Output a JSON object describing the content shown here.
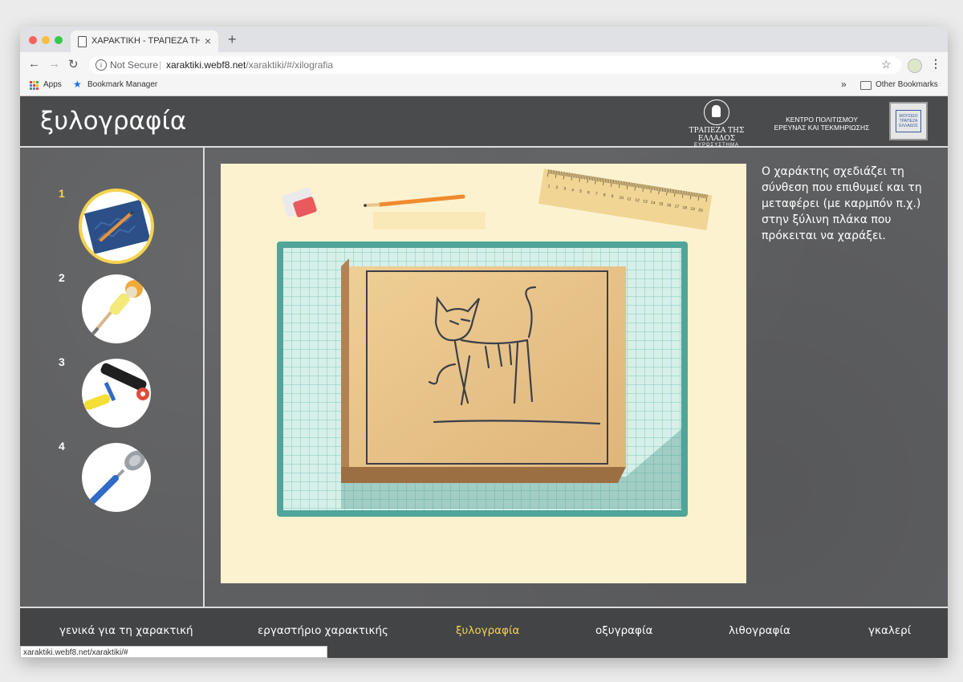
{
  "browser": {
    "tab_title": "ΧΑΡΑΚΤΙΚΗ - ΤΡΑΠΕΖΑ ΤΗΣ Ε",
    "new_tab_glyph": "+",
    "tab_close_glyph": "×",
    "security_label": "Not Secure",
    "url_host": "xaraktiki.webf8.net",
    "url_path": "/xaraktiki/#/xilografia",
    "bookmarks": {
      "apps_label": "Apps",
      "manager_label": "Bookmark Manager",
      "overflow_glyph": "»",
      "other_label": "Other Bookmarks"
    },
    "status_url": "xaraktiki.webf8.net/xaraktiki/#",
    "colors": {
      "close": "#fc605b",
      "minimize": "#fdbc40",
      "maximize": "#34c84a"
    }
  },
  "header": {
    "title": "ξυλογραφία",
    "bank_name": "ΤΡΑΠΕΖΑ ΤΗΣ ΕΛΛΑΔΟΣ",
    "bank_sub": "ΕΥΡΩΣΥΣΤΗΜΑ",
    "centre_line1": "ΚΕΝΤΡΟ ΠΟΛΙΤΙΣΜΟΥ",
    "centre_line2": "ΕΡΕΥΝΑΣ ΚΑΙ ΤΕΚΜΗΡΙΩΣΗΣ",
    "museum_logo_text": "ΜΟΥΣΕΙΟ ΤΡΑΠΕΖΑ ΕΛΛΑΔΟΣ"
  },
  "steps": [
    {
      "number": "1",
      "icon": "sketch-paper-pencil-icon",
      "active": true
    },
    {
      "number": "2",
      "icon": "gouge-tool-icon",
      "active": false
    },
    {
      "number": "3",
      "icon": "ink-roller-icon",
      "active": false
    },
    {
      "number": "4",
      "icon": "spoon-icon",
      "active": false
    }
  ],
  "description": "Ο χαράκτης σχεδιάζει τη σύνθεση που επιθυμεί και τη μεταφέρει (με καρμπόν π.χ.) στην ξύλινη πλάκα που πρόκειται να χαράξει.",
  "illustration": {
    "ruler_numbers": [
      "1",
      "2",
      "3",
      "4",
      "5",
      "6",
      "7",
      "8",
      "9",
      "10",
      "11",
      "12",
      "13",
      "14",
      "15",
      "16",
      "17",
      "18",
      "19",
      "20"
    ]
  },
  "nav": [
    {
      "label": "γενικά για τη χαρακτική",
      "active": false
    },
    {
      "label": "εργαστήριο χαρακτικής",
      "active": false
    },
    {
      "label": "ξυλογραφία",
      "active": true
    },
    {
      "label": "οξυγραφία",
      "active": false
    },
    {
      "label": "λιθογραφία",
      "active": false
    },
    {
      "label": "γκαλερί",
      "active": false
    }
  ],
  "theme": {
    "accent": "#f5d34e",
    "mat": "#4fa59a",
    "wood": "#e8c48a",
    "paper": "#fdf2cf"
  }
}
